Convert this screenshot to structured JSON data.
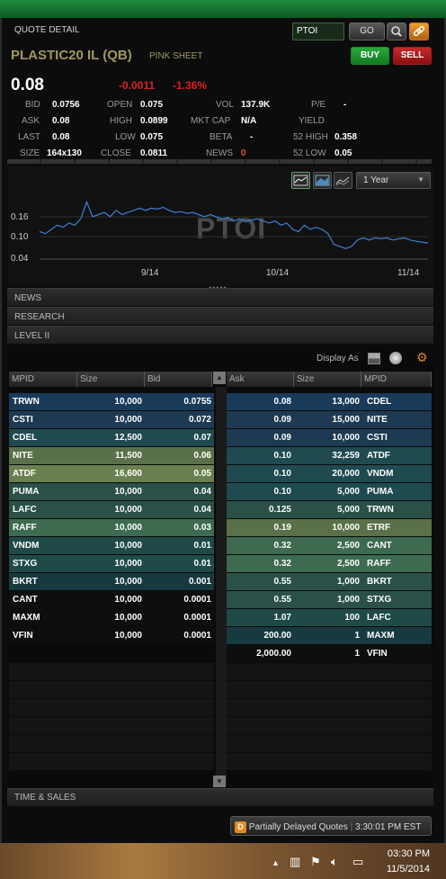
{
  "header": {
    "title": "QUOTE DETAIL",
    "symbol_value": "PTOI",
    "go_label": "GO",
    "buy_label": "BUY",
    "sell_label": "SELL"
  },
  "security": {
    "name": "PLASTIC20 IL (QB)",
    "market": "PINK SHEET",
    "last": "0.08",
    "change": "-0.0011",
    "change_pct": "-1.36%"
  },
  "quote": {
    "bid_l": "BID",
    "bid": "0.0756",
    "open_l": "OPEN",
    "open": "0.075",
    "vol_l": "VOL",
    "vol": "137.9K",
    "pe_l": "P/E",
    "pe": "-",
    "ask_l": "ASK",
    "ask": "0.08",
    "high_l": "HIGH",
    "high": "0.0899",
    "mktcap_l": "MKT CAP",
    "mktcap": "N/A",
    "yield_l": "YIELD",
    "yield": "",
    "last_l": "LAST",
    "last": "0.08",
    "low_l": "LOW",
    "low": "0.075",
    "beta_l": "BETA",
    "beta": "-",
    "h52_l": "52 HIGH",
    "h52": "0.358",
    "size_l": "SIZE",
    "size": "164x130",
    "close_l": "CLOSE",
    "close": "0.0811",
    "news_l": "NEWS",
    "news": "0",
    "l52_l": "52 LOW",
    "l52": "0.05"
  },
  "chart": {
    "range": "1 Year",
    "watermark": "PTOI",
    "yticks": [
      "0.16",
      "0.10",
      "0.04"
    ],
    "xticks": [
      "9/14",
      "10/14",
      "11/14"
    ]
  },
  "chart_data": {
    "type": "line",
    "ylim": [
      0.04,
      0.18
    ],
    "y": [
      0.105,
      0.1,
      0.11,
      0.12,
      0.115,
      0.125,
      0.12,
      0.135,
      0.175,
      0.14,
      0.145,
      0.15,
      0.14,
      0.155,
      0.145,
      0.15,
      0.155,
      0.16,
      0.155,
      0.16,
      0.158,
      0.162,
      0.155,
      0.15,
      0.152,
      0.148,
      0.15,
      0.145,
      0.14,
      0.145,
      0.14,
      0.135,
      0.138,
      0.13,
      0.135,
      0.128,
      0.132,
      0.135,
      0.13,
      0.125,
      0.13,
      0.12,
      0.125,
      0.11,
      0.105,
      0.12,
      0.11,
      0.115,
      0.11,
      0.1,
      0.075,
      0.07,
      0.065,
      0.07,
      0.085,
      0.09,
      0.085,
      0.09,
      0.088,
      0.09,
      0.085,
      0.088,
      0.09,
      0.085,
      0.082,
      0.08,
      0.078
    ]
  },
  "sections": {
    "news": "NEWS",
    "research": "RESEARCH",
    "level2": "LEVEL II",
    "ts": "TIME & SALES"
  },
  "level2": {
    "display_as": "Display As",
    "cols": {
      "mpid": "MPID",
      "size": "Size",
      "bid": "Bid",
      "ask": "Ask",
      "size2": "Size",
      "mpid2": "MPID"
    },
    "bids": [
      {
        "mpid": "TRWN",
        "size": "10,000",
        "price": "0.0755",
        "color": "#1a3a5a"
      },
      {
        "mpid": "CSTI",
        "size": "10,000",
        "price": "0.072",
        "color": "#1e3a52"
      },
      {
        "mpid": "CDEL",
        "size": "12,500",
        "price": "0.07",
        "color": "#1f4a50"
      },
      {
        "mpid": "NITE",
        "size": "11,500",
        "price": "0.06",
        "color": "#5a7048"
      },
      {
        "mpid": "ATDF",
        "size": "16,600",
        "price": "0.05",
        "color": "#6a8050"
      },
      {
        "mpid": "PUMA",
        "size": "10,000",
        "price": "0.04",
        "color": "#2a5048"
      },
      {
        "mpid": "LAFC",
        "size": "10,000",
        "price": "0.04",
        "color": "#2a5048"
      },
      {
        "mpid": "RAFF",
        "size": "10,000",
        "price": "0.03",
        "color": "#3e6a50"
      },
      {
        "mpid": "VNDM",
        "size": "10,000",
        "price": "0.01",
        "color": "#1f4a48"
      },
      {
        "mpid": "STXG",
        "size": "10,000",
        "price": "0.01",
        "color": "#1f4a48"
      },
      {
        "mpid": "BKRT",
        "size": "10,000",
        "price": "0.001",
        "color": "#173a40"
      },
      {
        "mpid": "CANT",
        "size": "10,000",
        "price": "0.0001",
        "color": "#0e0e0e"
      },
      {
        "mpid": "MAXM",
        "size": "10,000",
        "price": "0.0001",
        "color": "#0e0e0e"
      },
      {
        "mpid": "VFIN",
        "size": "10,000",
        "price": "0.0001",
        "color": "#0e0e0e"
      }
    ],
    "asks": [
      {
        "price": "0.08",
        "size": "13,000",
        "mpid": "CDEL",
        "color": "#1a3a5a"
      },
      {
        "price": "0.09",
        "size": "15,000",
        "mpid": "NITE",
        "color": "#1e3a52"
      },
      {
        "price": "0.09",
        "size": "10,000",
        "mpid": "CSTI",
        "color": "#1e3a52"
      },
      {
        "price": "0.10",
        "size": "32,259",
        "mpid": "ATDF",
        "color": "#1f4a50"
      },
      {
        "price": "0.10",
        "size": "20,000",
        "mpid": "VNDM",
        "color": "#1f4a50"
      },
      {
        "price": "0.10",
        "size": "5,000",
        "mpid": "PUMA",
        "color": "#1f4a50"
      },
      {
        "price": "0.125",
        "size": "5,000",
        "mpid": "TRWN",
        "color": "#2a5048"
      },
      {
        "price": "0.19",
        "size": "10,000",
        "mpid": "ETRF",
        "color": "#5a7048"
      },
      {
        "price": "0.32",
        "size": "2,500",
        "mpid": "CANT",
        "color": "#3e6a50"
      },
      {
        "price": "0.32",
        "size": "2,500",
        "mpid": "RAFF",
        "color": "#3e6a50"
      },
      {
        "price": "0.55",
        "size": "1,000",
        "mpid": "BKRT",
        "color": "#2a5048"
      },
      {
        "price": "0.55",
        "size": "1,000",
        "mpid": "STXG",
        "color": "#2a5048"
      },
      {
        "price": "1.07",
        "size": "100",
        "mpid": "LAFC",
        "color": "#1f4a48"
      },
      {
        "price": "200.00",
        "size": "1",
        "mpid": "MAXM",
        "color": "#173a40"
      },
      {
        "price": "2,000.00",
        "size": "1",
        "mpid": "VFIN",
        "color": "#0e0e0e"
      }
    ]
  },
  "status": {
    "quotes": "Partially Delayed Quotes",
    "time": "3:30:01 PM EST"
  },
  "taskbar": {
    "time": "03:30 PM",
    "date": "11/5/2014"
  }
}
